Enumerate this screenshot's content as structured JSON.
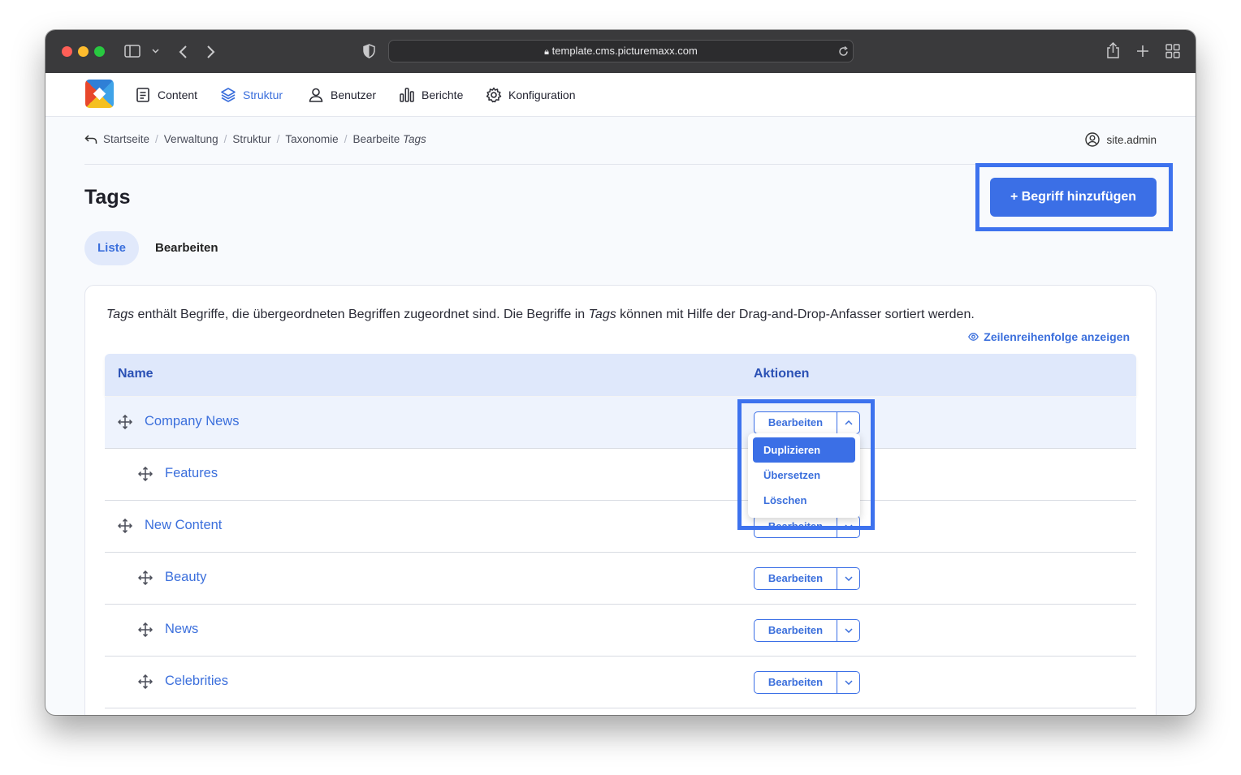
{
  "browser": {
    "url": "template.cms.picturemaxx.com"
  },
  "nav": {
    "items": [
      {
        "label": "Content",
        "icon": "document-icon"
      },
      {
        "label": "Struktur",
        "icon": "layers-icon",
        "active": true
      },
      {
        "label": "Benutzer",
        "icon": "user-icon"
      },
      {
        "label": "Berichte",
        "icon": "bar-chart-icon"
      },
      {
        "label": "Konfiguration",
        "icon": "gear-icon"
      }
    ]
  },
  "breadcrumb": {
    "items": [
      "Startseite",
      "Verwaltung",
      "Struktur",
      "Taxonomie"
    ],
    "current_prefix": "Bearbeite",
    "current_em": "Tags"
  },
  "user": {
    "name": "site.admin"
  },
  "page": {
    "title": "Tags",
    "add_button": "+ Begriff hinzufügen",
    "tabs": [
      "Liste",
      "Bearbeiten"
    ]
  },
  "description": {
    "em1": "Tags",
    "part1": " enthält Begriffe, die übergeordneten Begriffen zugeordnet sind. Die Begriffe in ",
    "em2": "Tags",
    "part2": " können mit Hilfe der Drag-and-Drop-Anfasser sortiert werden."
  },
  "show_order": "Zeilenreihenfolge anzeigen",
  "table": {
    "headers": [
      "Name",
      "Aktionen"
    ],
    "rows": [
      {
        "name": "Company News",
        "level": 0
      },
      {
        "name": "Features",
        "level": 1
      },
      {
        "name": "New Content",
        "level": 0
      },
      {
        "name": "Beauty",
        "level": 1
      },
      {
        "name": "News",
        "level": 1
      },
      {
        "name": "Celebrities",
        "level": 1
      }
    ],
    "action_label": "Bearbeiten"
  },
  "dropdown": {
    "items": [
      "Duplizieren",
      "Übersetzen",
      "Löschen"
    ]
  },
  "colors": {
    "accent": "#3b6fe6",
    "header_bg": "#dfe8fb",
    "highlight": "#3d72ee"
  }
}
